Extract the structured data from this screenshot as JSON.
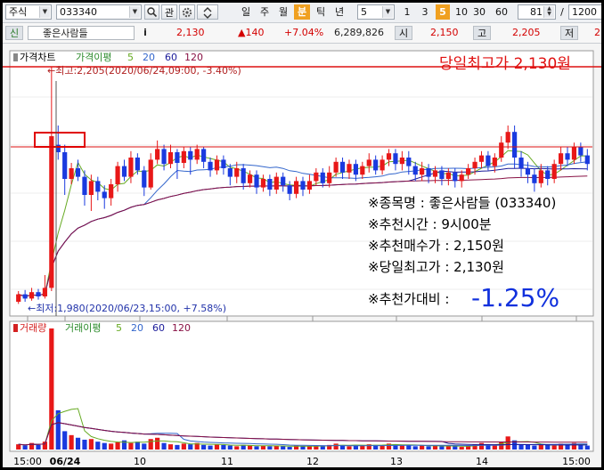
{
  "toolbar": {
    "market": "주식",
    "code": "033340",
    "btn_kwan": "관",
    "periods": [
      "일",
      "주",
      "월",
      "분",
      "틱",
      "년"
    ],
    "active_period": "분",
    "interval": "5",
    "quick": [
      "1",
      "3",
      "5",
      "10",
      "30",
      "60"
    ],
    "active_quick": "5",
    "count": "81",
    "slash": "/",
    "total": "1200"
  },
  "quote": {
    "tag": "신",
    "name": "좋은사람들",
    "info_label": "i",
    "price": "2,130",
    "change": "▲140",
    "change_pct": "+7.04%",
    "volume": "6,289,826",
    "open_label": "시",
    "open": "2,150",
    "high_label": "고",
    "high": "2,205",
    "low_label": "저",
    "low": "2"
  },
  "chart_data": [
    {
      "type": "candlestick",
      "title": "가격차트",
      "legend": [
        "가격이평",
        "5",
        "20",
        "60",
        "120"
      ],
      "max_label": "←최고:2,205(2020/06/24,09:00, -3.40%)",
      "min_label": "←최저:1,980(2020/06/23,15:00, +7.58%)",
      "headline": "당일최고가 2,130원",
      "y_range": [
        1975,
        2215
      ],
      "ref_lines": [
        2205,
        2130
      ],
      "series": [
        {
          "name": "5",
          "color": "#66aa22"
        },
        {
          "name": "20",
          "color": "#3366cc"
        },
        {
          "name": "60",
          "color": "#1a1a99"
        },
        {
          "name": "120",
          "color": "#881144"
        }
      ],
      "candles": [
        [
          1985,
          1992,
          1983,
          1995
        ],
        [
          1992,
          1988,
          1985,
          1996
        ],
        [
          1988,
          1994,
          1986,
          1998
        ],
        [
          1994,
          1990,
          1987,
          1997
        ],
        [
          1990,
          1998,
          1988,
          2010
        ],
        [
          1998,
          2140,
          1995,
          2205
        ],
        [
          2132,
          2125,
          2118,
          2150
        ],
        [
          2125,
          2100,
          2085,
          2132
        ],
        [
          2100,
          2110,
          2095,
          2115
        ],
        [
          2110,
          2102,
          2098,
          2118
        ],
        [
          2102,
          2085,
          2075,
          2108
        ],
        [
          2085,
          2098,
          2070,
          2104
        ],
        [
          2098,
          2088,
          2080,
          2102
        ],
        [
          2088,
          2082,
          2072,
          2094
        ],
        [
          2082,
          2095,
          2075,
          2100
        ],
        [
          2095,
          2112,
          2088,
          2116
        ],
        [
          2112,
          2102,
          2098,
          2118
        ],
        [
          2102,
          2120,
          2096,
          2126
        ],
        [
          2120,
          2108,
          2104,
          2124
        ],
        [
          2108,
          2092,
          2084,
          2112
        ],
        [
          2092,
          2118,
          2090,
          2124
        ],
        [
          2118,
          2128,
          2114,
          2136
        ],
        [
          2128,
          2114,
          2108,
          2132
        ],
        [
          2114,
          2125,
          2110,
          2132
        ],
        [
          2125,
          2115,
          2100,
          2128
        ],
        [
          2115,
          2126,
          2110,
          2130
        ],
        [
          2126,
          2118,
          2104,
          2130
        ],
        [
          2118,
          2128,
          2114,
          2132
        ],
        [
          2128,
          2116,
          2110,
          2130
        ],
        [
          2116,
          2108,
          2102,
          2120
        ],
        [
          2108,
          2118,
          2104,
          2122
        ],
        [
          2118,
          2110,
          2104,
          2122
        ],
        [
          2110,
          2102,
          2094,
          2114
        ],
        [
          2102,
          2110,
          2096,
          2116
        ],
        [
          2110,
          2096,
          2090,
          2114
        ],
        [
          2096,
          2104,
          2092,
          2108
        ],
        [
          2104,
          2092,
          2086,
          2108
        ],
        [
          2092,
          2100,
          2088,
          2104
        ],
        [
          2100,
          2090,
          2084,
          2104
        ],
        [
          2090,
          2102,
          2086,
          2106
        ],
        [
          2102,
          2094,
          2088,
          2106
        ],
        [
          2094,
          2086,
          2080,
          2098
        ],
        [
          2086,
          2098,
          2082,
          2102
        ],
        [
          2098,
          2090,
          2084,
          2102
        ],
        [
          2090,
          2098,
          2086,
          2104
        ],
        [
          2098,
          2106,
          2094,
          2110
        ],
        [
          2106,
          2096,
          2092,
          2110
        ],
        [
          2096,
          2106,
          2092,
          2112
        ],
        [
          2106,
          2116,
          2102,
          2120
        ],
        [
          2116,
          2106,
          2100,
          2120
        ],
        [
          2106,
          2114,
          2100,
          2118
        ],
        [
          2114,
          2104,
          2098,
          2118
        ],
        [
          2104,
          2112,
          2100,
          2116
        ],
        [
          2112,
          2118,
          2106,
          2124
        ],
        [
          2118,
          2108,
          2104,
          2122
        ],
        [
          2108,
          2118,
          2104,
          2122
        ],
        [
          2118,
          2124,
          2112,
          2128
        ],
        [
          2124,
          2114,
          2108,
          2128
        ],
        [
          2114,
          2120,
          2108,
          2126
        ],
        [
          2120,
          2112,
          2104,
          2126
        ],
        [
          2112,
          2104,
          2098,
          2116
        ],
        [
          2104,
          2110,
          2098,
          2116
        ],
        [
          2110,
          2102,
          2096,
          2114
        ],
        [
          2102,
          2108,
          2096,
          2112
        ],
        [
          2108,
          2100,
          2094,
          2112
        ],
        [
          2100,
          2106,
          2094,
          2110
        ],
        [
          2106,
          2098,
          2092,
          2110
        ],
        [
          2098,
          2104,
          2092,
          2108
        ],
        [
          2104,
          2110,
          2100,
          2114
        ],
        [
          2110,
          2116,
          2104,
          2120
        ],
        [
          2116,
          2122,
          2110,
          2126
        ],
        [
          2122,
          2112,
          2108,
          2126
        ],
        [
          2112,
          2120,
          2106,
          2124
        ],
        [
          2120,
          2134,
          2116,
          2140
        ],
        [
          2134,
          2144,
          2128,
          2150
        ],
        [
          2144,
          2120,
          2110,
          2150
        ],
        [
          2120,
          2110,
          2102,
          2126
        ],
        [
          2110,
          2104,
          2096,
          2116
        ],
        [
          2104,
          2096,
          2088,
          2110
        ],
        [
          2096,
          2108,
          2092,
          2114
        ],
        [
          2108,
          2100,
          2094,
          2112
        ],
        [
          2100,
          2114,
          2096,
          2118
        ],
        [
          2114,
          2124,
          2108,
          2130
        ],
        [
          2124,
          2118,
          2112,
          2130
        ],
        [
          2118,
          2130,
          2114,
          2134
        ],
        [
          2130,
          2122,
          2116,
          2134
        ],
        [
          2122,
          2114,
          2108,
          2128
        ]
      ],
      "annotations": [
        "※종목명 : 좋은사람들 (033340)",
        "※추천시간 : 9시00분",
        "※추천매수가 : 2,150원",
        "※당일최고가 : 2,130원"
      ],
      "ratio_label": "※추천가대비 :",
      "ratio_value": "-1.25%"
    },
    {
      "type": "bar",
      "title": "거래량",
      "legend": [
        "거래이평",
        "5",
        "20",
        "60",
        "120"
      ],
      "volumes": [
        8,
        6,
        10,
        7,
        12,
        185,
        60,
        28,
        22,
        18,
        15,
        16,
        12,
        10,
        9,
        11,
        14,
        10,
        12,
        9,
        16,
        18,
        10,
        8,
        7,
        9,
        8,
        10,
        7,
        6,
        8,
        7,
        6,
        5,
        7,
        6,
        5,
        6,
        5,
        6,
        5,
        4,
        6,
        5,
        5,
        6,
        5,
        7,
        9,
        6,
        5,
        7,
        6,
        8,
        7,
        6,
        9,
        8,
        6,
        7,
        5,
        6,
        5,
        6,
        5,
        6,
        5,
        4,
        6,
        8,
        10,
        7,
        6,
        12,
        20,
        14,
        8,
        7,
        6,
        8,
        7,
        6,
        9,
        8,
        10,
        7,
        6
      ]
    }
  ],
  "x_axis": {
    "labels": [
      "15:00",
      "06/24",
      "10",
      "11",
      "12",
      "13",
      "14",
      "15:00"
    ],
    "bold": "06/24"
  }
}
